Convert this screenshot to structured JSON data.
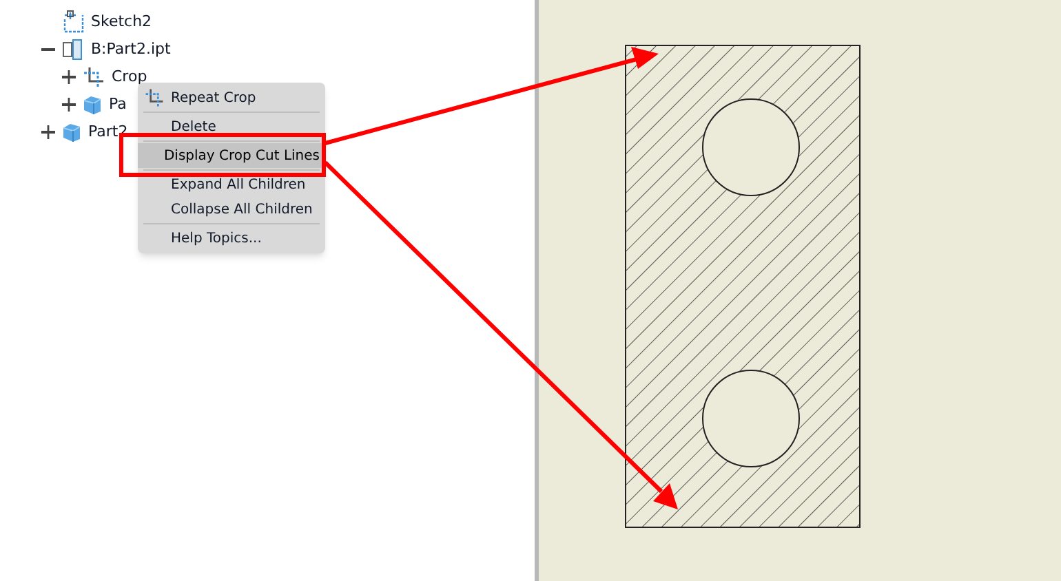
{
  "tree": [
    {
      "label": "Sketch2",
      "kind": "sketch"
    },
    {
      "label": "B:Part2.ipt",
      "kind": "assembly",
      "expanded": true,
      "children": [
        {
          "label": "Crop",
          "kind": "crop",
          "expanded": false
        },
        {
          "label": "Pa",
          "kind": "part",
          "expanded": false
        }
      ]
    },
    {
      "label": "Part2",
      "kind": "part",
      "expanded": false
    }
  ],
  "context_menu": {
    "items": [
      {
        "label": "Repeat Crop",
        "kind": "crop",
        "selected": false,
        "separator_before": false
      },
      {
        "label": "Delete",
        "selected": false,
        "separator_before": true
      },
      {
        "label": "Display Crop Cut Lines",
        "selected": true,
        "separator_before": true
      },
      {
        "label": "Expand All Children",
        "selected": false,
        "separator_before": true
      },
      {
        "label": "Collapse All Children",
        "selected": false,
        "separator_before": false
      },
      {
        "label": "Help Topics...",
        "selected": false,
        "separator_before": true
      }
    ]
  }
}
